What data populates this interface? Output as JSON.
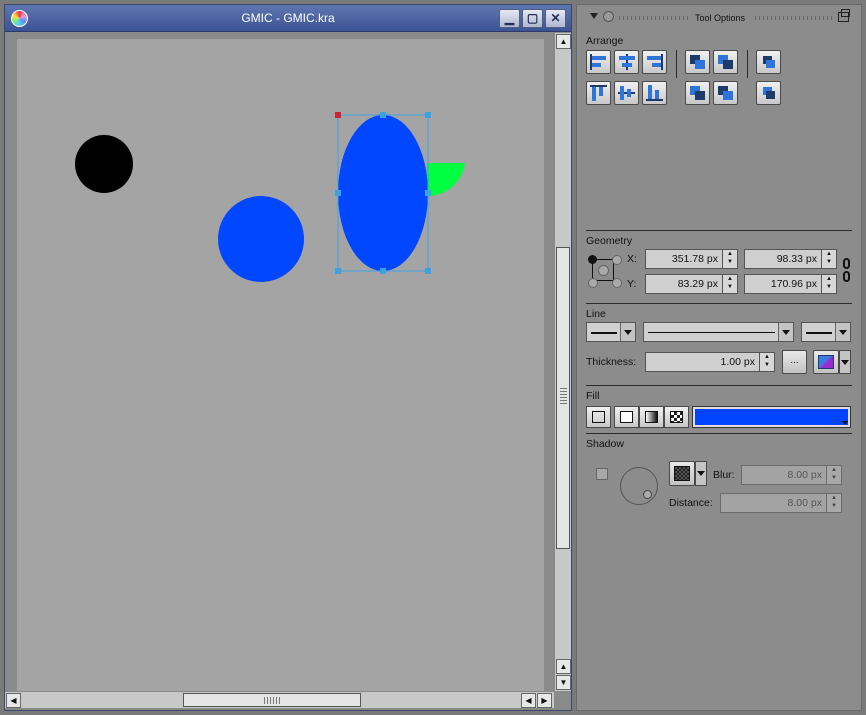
{
  "window": {
    "title": "GMIC - GMIC.kra",
    "minimize_glyph": "▁",
    "maximize_glyph": "▢",
    "close_glyph": "✕"
  },
  "canvas": {
    "background": "#a4a4a4",
    "shapes": [
      {
        "name": "black-circle",
        "kind": "ellipse",
        "color": "#000000"
      },
      {
        "name": "blue-circle",
        "kind": "ellipse",
        "color": "#0047ff"
      },
      {
        "name": "green-quarter-circle",
        "kind": "pie",
        "color": "#00ff41"
      },
      {
        "name": "blue-ellipse-selected",
        "kind": "ellipse",
        "color": "#0047ff",
        "selected": true
      }
    ],
    "selection_handle_color": "#3fa2e0",
    "rotation_handle_color": "#cc2233"
  },
  "docker": {
    "title": "Tool Options",
    "arrange": {
      "label": "Arrange"
    },
    "geometry": {
      "label": "Geometry",
      "x_label": "X:",
      "y_label": "Y:",
      "x_value": "351.78 px",
      "y_value": "83.29 px",
      "width_value": "98.33 px",
      "height_value": "170.96 px"
    },
    "line": {
      "label": "Line",
      "thickness_label": "Thickness:",
      "thickness_value": "1.00 px",
      "cap_button": "..."
    },
    "fill": {
      "label": "Fill",
      "color": "#0044ff"
    },
    "shadow": {
      "label": "Shadow",
      "blur_label": "Blur:",
      "blur_value": "8.00 px",
      "distance_label": "Distance:",
      "distance_value": "8.00 px"
    }
  }
}
